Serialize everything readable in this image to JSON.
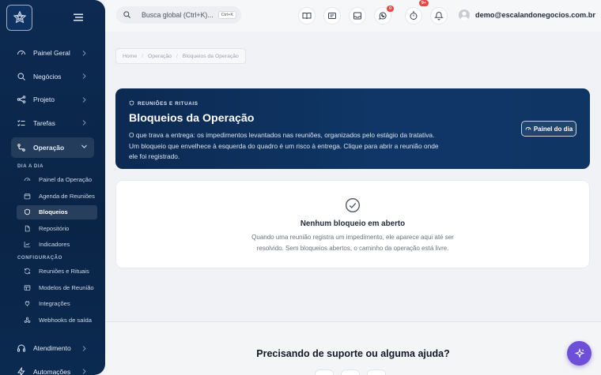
{
  "sidebar": {
    "nav": [
      {
        "label": "Painel Geral",
        "icon": "gauge-icon"
      },
      {
        "label": "Negócios",
        "icon": "search-icon"
      },
      {
        "label": "Projeto",
        "icon": "network-icon"
      },
      {
        "label": "Tarefas",
        "icon": "checklist-icon"
      },
      {
        "label": "Operação",
        "icon": "workflow-icon"
      }
    ],
    "section_day": "DIA A DIA",
    "day_items": [
      {
        "label": "Painel da Operação",
        "icon": "gauge-icon"
      },
      {
        "label": "Agenda de Reuniões",
        "icon": "calendar-icon"
      },
      {
        "label": "Bloqueios",
        "icon": "shield-icon"
      },
      {
        "label": "Repositório",
        "icon": "file-icon"
      },
      {
        "label": "Indicadores",
        "icon": "chart-icon"
      }
    ],
    "section_config": "CONFIGURAÇÃO",
    "config_items": [
      {
        "label": "Reuniões e Rituais",
        "icon": "refresh-icon"
      },
      {
        "label": "Modelos de Reunião",
        "icon": "template-icon"
      },
      {
        "label": "Integrações",
        "icon": "plug-icon"
      },
      {
        "label": "Webhooks de saída",
        "icon": "webhook-icon"
      }
    ],
    "bottom": [
      {
        "label": "Atendimento",
        "icon": "headset-icon"
      },
      {
        "label": "Automações",
        "icon": "bolt-icon"
      }
    ]
  },
  "topbar": {
    "search_placeholder": "Busca global (Ctrl+K)...",
    "search_shortcut": "Ctrl+K",
    "badges": {
      "whatsapp": "0",
      "notifications": "9+"
    },
    "user_email": "demo@escalandonegocios.com.br"
  },
  "breadcrumb": [
    "Home",
    "Operação",
    "Bloqueios da Operação"
  ],
  "hero": {
    "eyebrow": "REUNIÕES E RITUAIS",
    "title": "Bloqueios da Operação",
    "description": "O que trava a entrega: os impedimentos levantados nas reuniões, organizados pelo estágio da tratativa. Um bloqueio que envelhece à esquerda do quadro é um risco à entrega. Clique para abrir a reunião onde ele foi registrado.",
    "button_label": "Painel do dia"
  },
  "empty_state": {
    "title": "Nenhum bloqueio em aberto",
    "description": "Quando uma reunião registra um impedimento, ele aparece aqui até ser resolvido. Sem bloqueios abertos, o caminho da operação está livre."
  },
  "footer": {
    "title": "Precisando de suporte ou alguma ajuda?"
  },
  "colors": {
    "sidebar_bg": "#0c2a52",
    "hero_bg": "#0f3666",
    "accent_purple": "#6d4fd8",
    "badge_red": "#ef4444"
  }
}
